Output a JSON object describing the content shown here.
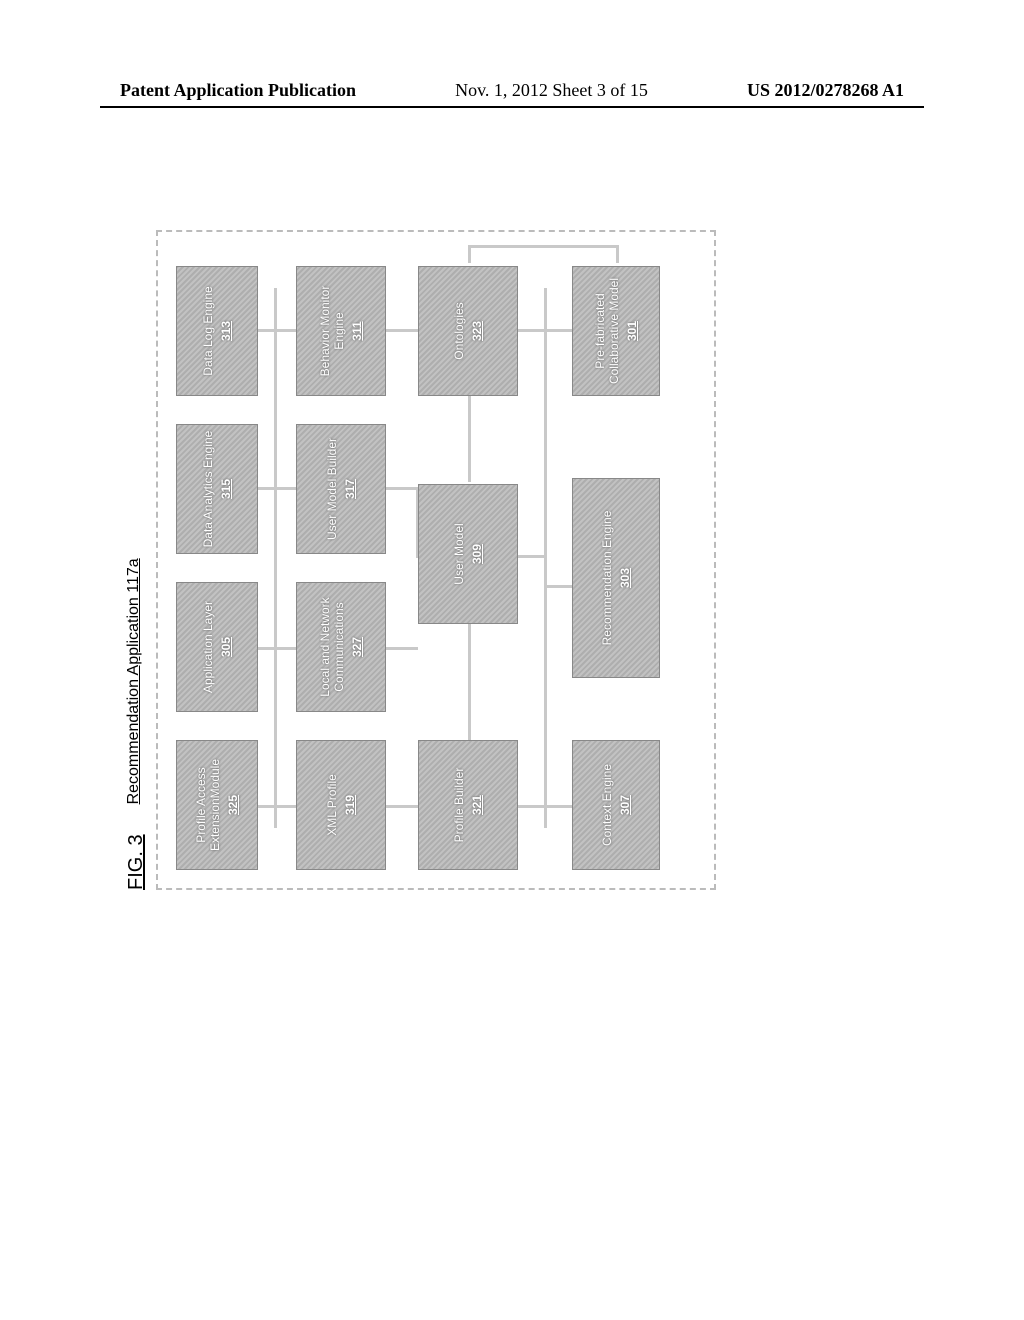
{
  "header": {
    "left": "Patent Application Publication",
    "center": "Nov. 1, 2012  Sheet 3 of 15",
    "right": "US 2012/0278268 A1"
  },
  "figure": {
    "label": "FIG. 3",
    "app_title": "Recommendation Application 117a"
  },
  "blocks": {
    "profile_access": {
      "title": "Profile Access ExtensionModule",
      "ref": "325"
    },
    "app_layer": {
      "title": "Application Layer",
      "ref": "305"
    },
    "data_analytics": {
      "title": "Data Analytics Engine",
      "ref": "315"
    },
    "data_log": {
      "title": "Data Log Engine",
      "ref": "313"
    },
    "xml_profile": {
      "title": "XML Profile",
      "ref": "319"
    },
    "local_net": {
      "title": "Local and Network Communications",
      "ref": "327"
    },
    "user_model_b": {
      "title": "User Model Builder",
      "ref": "317"
    },
    "behavior_mon": {
      "title": "Behavior Monitor Engine",
      "ref": "311"
    },
    "profile_builder": {
      "title": "Profile Builder",
      "ref": "321"
    },
    "user_model": {
      "title": "User Model",
      "ref": "309"
    },
    "ontologies": {
      "title": "Ontologies",
      "ref": "323"
    },
    "context_engine": {
      "title": "Context Engine",
      "ref": "307"
    },
    "rec_engine": {
      "title": "Recommendation Engine",
      "ref": "303"
    },
    "prefab": {
      "title": "Pre-fabricated Collaborative Model",
      "ref": "301"
    }
  }
}
